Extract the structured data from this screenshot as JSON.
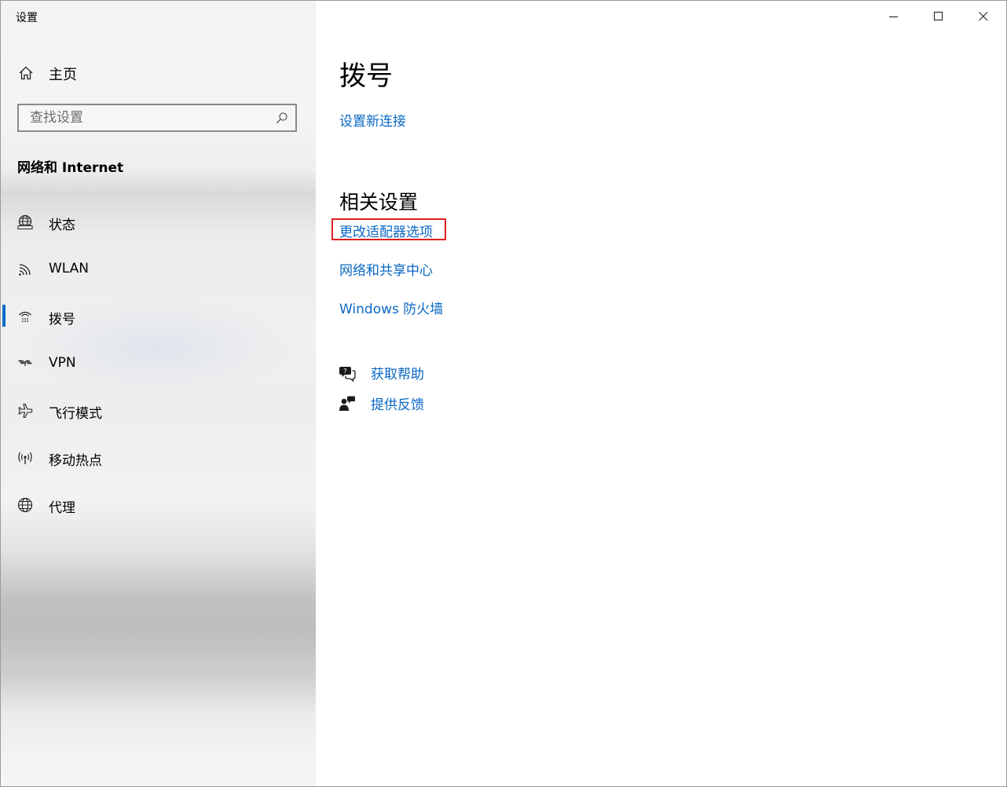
{
  "window": {
    "title": "设置"
  },
  "sidebar": {
    "home_label": "主页",
    "search_placeholder": "查找设置",
    "section_title": "网络和 Internet",
    "items": [
      {
        "label": "状态",
        "icon": "globe-status-icon"
      },
      {
        "label": "WLAN",
        "icon": "wifi-icon"
      },
      {
        "label": "拨号",
        "icon": "dialup-icon",
        "selected": true
      },
      {
        "label": "VPN",
        "icon": "vpn-icon"
      },
      {
        "label": "飞行模式",
        "icon": "airplane-icon"
      },
      {
        "label": "移动热点",
        "icon": "hotspot-icon"
      },
      {
        "label": "代理",
        "icon": "globe-icon"
      }
    ]
  },
  "main": {
    "page_title": "拨号",
    "setup_link": "设置新连接",
    "related_title": "相关设置",
    "related_links": [
      "更改适配器选项",
      "网络和共享中心",
      "Windows 防火墙"
    ],
    "help": {
      "get_help": "获取帮助",
      "feedback": "提供反馈"
    }
  },
  "colors": {
    "accent": "#0a68c4",
    "highlight_box": "#e02020"
  }
}
